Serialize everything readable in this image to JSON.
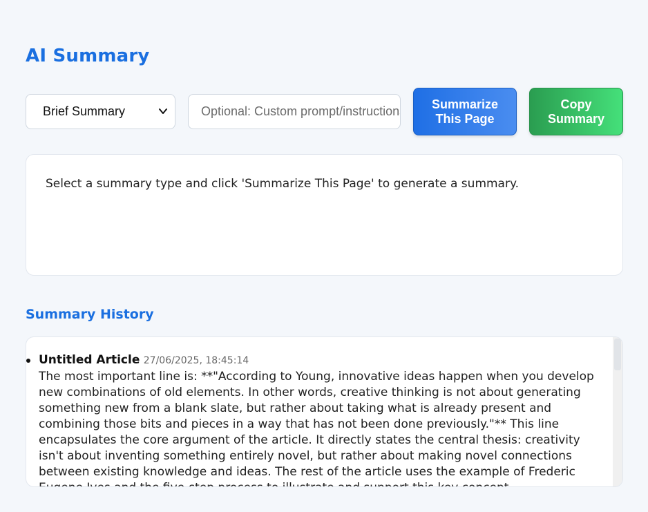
{
  "app": {
    "title": "AI Summary"
  },
  "controls": {
    "summary_type": "Brief Summary",
    "prompt_placeholder": "Optional: Custom prompt/instructions",
    "summarize_button": "Summarize This Page",
    "copy_button": "Copy Summary"
  },
  "output": {
    "text": "Select a summary type and click 'Summarize This Page' to generate a summary."
  },
  "history": {
    "heading": "Summary History",
    "items": [
      {
        "title": "Untitled Article",
        "date": "27/06/2025, 18:45:14",
        "text": "The most important line is: **\"According to Young, innovative ideas happen when you develop new combinations of old elements. In other words, creative thinking is not about generating something new from a blank slate, but rather about taking what is already present and combining those bits and pieces in a way that has not been done previously.\"** This line encapsulates the core argument of the article. It directly states the central thesis: creativity isn't about inventing something entirely novel, but rather about making novel connections between existing knowledge and ideas. The rest of the article uses the example of Frederic Eugene Ives and the five-step process to illustrate and support this key concept."
      }
    ]
  },
  "icons": {
    "dropdown": "chevron-down-icon"
  },
  "colors": {
    "accent": "#1a6fe0",
    "summarize": "#1f6fe5",
    "copy": "#2a9d50"
  }
}
